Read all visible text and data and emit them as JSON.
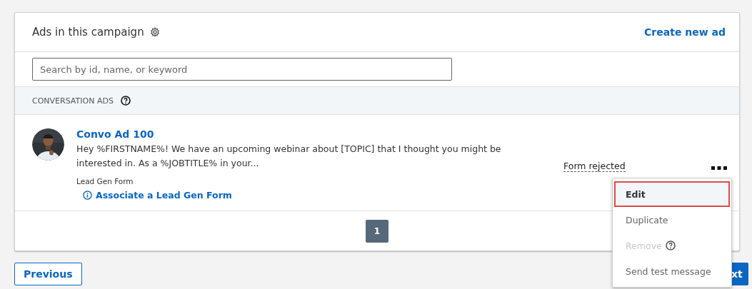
{
  "card": {
    "title": "Ads in this campaign",
    "create_link": "Create new ad"
  },
  "search": {
    "placeholder": "Search by id, name, or keyword"
  },
  "section": {
    "label": "CONVERSATION ADS"
  },
  "ads": [
    {
      "name": "Convo Ad 100",
      "text": "Hey %FIRSTNAME%! We have an upcoming webinar about [TOPIC] that I thought you might be interested in. As a %JOBTITLE% in your...",
      "form_label": "Lead Gen Form",
      "form_link": "Associate a Lead Gen Form",
      "status": "Form rejected"
    }
  ],
  "pagination": [
    {
      "label": "1",
      "selected": true
    }
  ],
  "menu": [
    {
      "label": "Edit",
      "selected": true,
      "disabled": false,
      "help": false
    },
    {
      "label": "Duplicate",
      "selected": false,
      "disabled": false,
      "help": false
    },
    {
      "label": "Remove",
      "selected": false,
      "disabled": true,
      "help": true
    },
    {
      "label": "Send test message",
      "selected": false,
      "disabled": false,
      "help": false
    }
  ],
  "footer": {
    "previous": "Previous",
    "next": "xt"
  }
}
